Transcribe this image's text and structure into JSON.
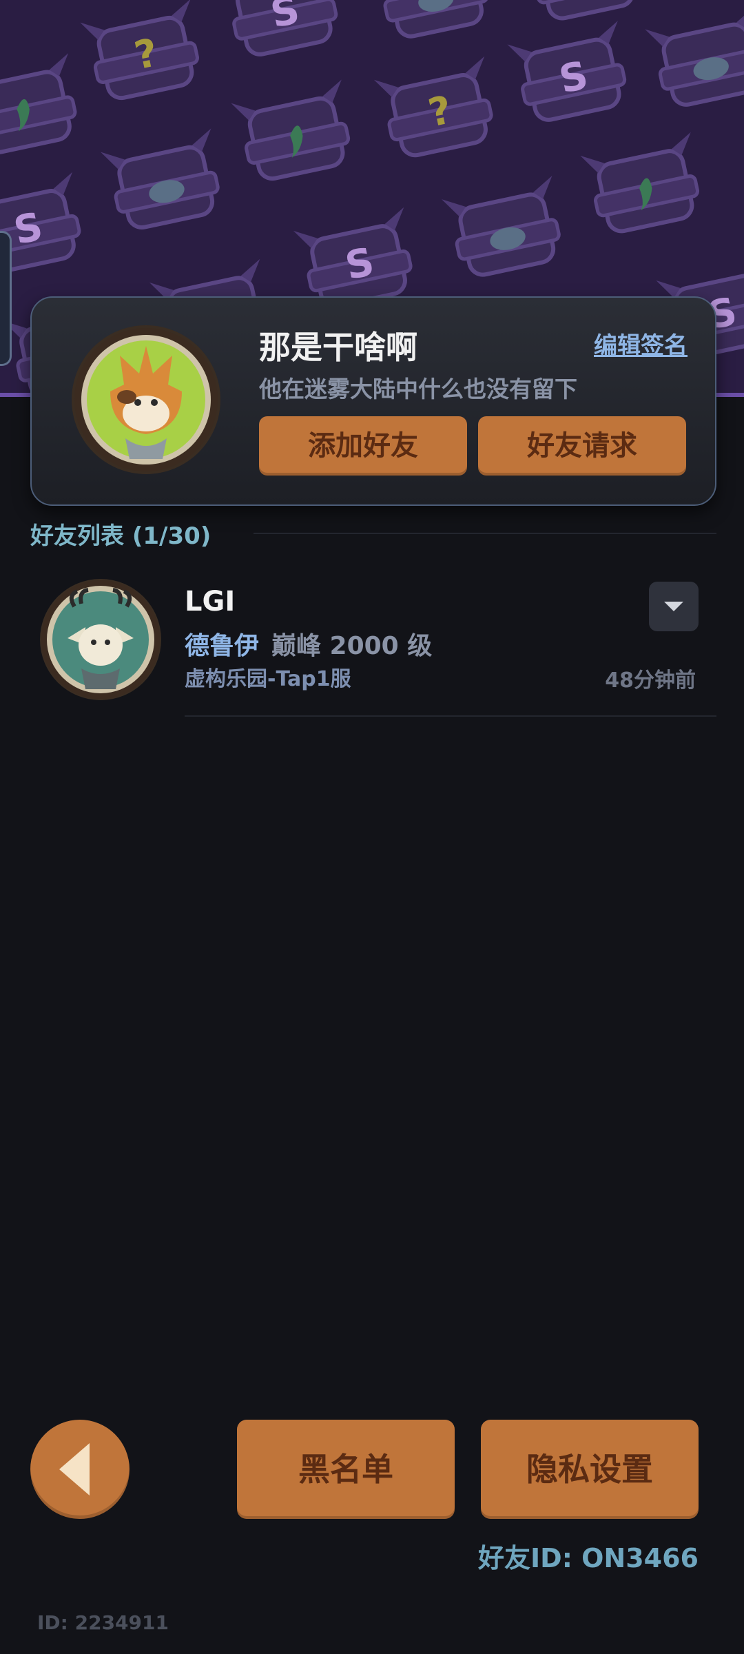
{
  "profile": {
    "name": "那是干啥啊",
    "signature": "他在迷雾大陆中什么也没有留下",
    "edit_label": "编辑签名",
    "add_friend_label": "添加好友",
    "friend_request_label": "好友请求"
  },
  "friend_list": {
    "title": "好友列表 (1/30)",
    "items": [
      {
        "name": "LGI",
        "class": "德鲁伊",
        "level": "巅峰 2000 级",
        "server": "虚构乐园-Tap1服",
        "last_seen": "48分钟前"
      }
    ]
  },
  "footer": {
    "blacklist_label": "黑名单",
    "privacy_label": "隐私设置",
    "friend_id": "好友ID: ON3466",
    "user_id": "ID: 2234911"
  },
  "colors": {
    "accent_orange": "#c0753a",
    "background": "#121318",
    "banner": "#2a1d43"
  }
}
